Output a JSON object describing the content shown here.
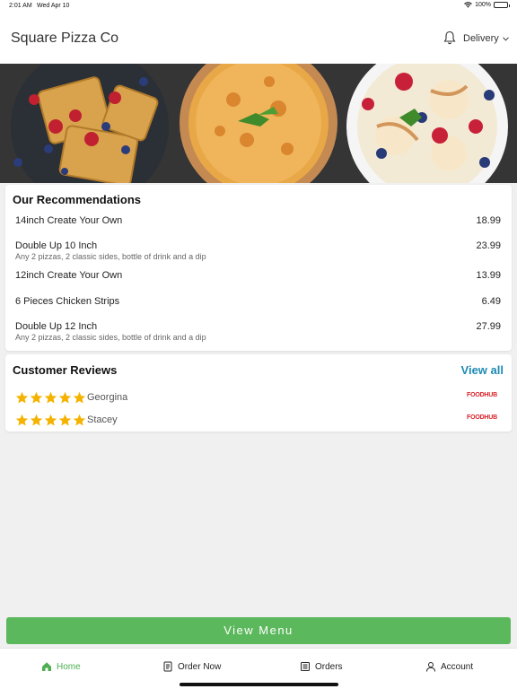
{
  "status_bar": {
    "time": "2:01 AM",
    "date": "Wed Apr 10",
    "battery": "100%",
    "battery_level": 1.0
  },
  "header": {
    "title": "Square Pizza Co",
    "delivery_label": "Delivery"
  },
  "recommendations": {
    "title": "Our Recommendations",
    "items": [
      {
        "name": "14inch Create Your Own",
        "price": "18.99",
        "description": ""
      },
      {
        "name": "Double Up 10 Inch",
        "price": "23.99",
        "description": "Any 2 pizzas, 2 classic sides, bottle of drink and a dip"
      },
      {
        "name": "12inch Create Your Own",
        "price": "13.99",
        "description": ""
      },
      {
        "name": "6 Pieces Chicken Strips",
        "price": "6.49",
        "description": ""
      },
      {
        "name": "Double Up 12 Inch",
        "price": "27.99",
        "description": "Any 2 pizzas, 2 classic sides, bottle of drink and a dip"
      }
    ]
  },
  "reviews": {
    "title": "Customer Reviews",
    "view_all_label": "View all",
    "items": [
      {
        "name": "Georgina",
        "rating": 5,
        "source": "FOODHUB"
      },
      {
        "name": "Stacey",
        "rating": 5,
        "source": "FOODHUB"
      }
    ]
  },
  "view_menu_label": "View Menu",
  "tabs": [
    {
      "label": "Home",
      "icon": "home-icon",
      "active": true
    },
    {
      "label": "Order Now",
      "icon": "order-icon",
      "active": false
    },
    {
      "label": "Orders",
      "icon": "orders-icon",
      "active": false
    },
    {
      "label": "Account",
      "icon": "account-icon",
      "active": false
    }
  ],
  "colors": {
    "accent_green": "#5cb85c",
    "link_blue": "#1f8ab3",
    "star_gold": "#f5b301",
    "foodhub_red": "#d8232a"
  }
}
